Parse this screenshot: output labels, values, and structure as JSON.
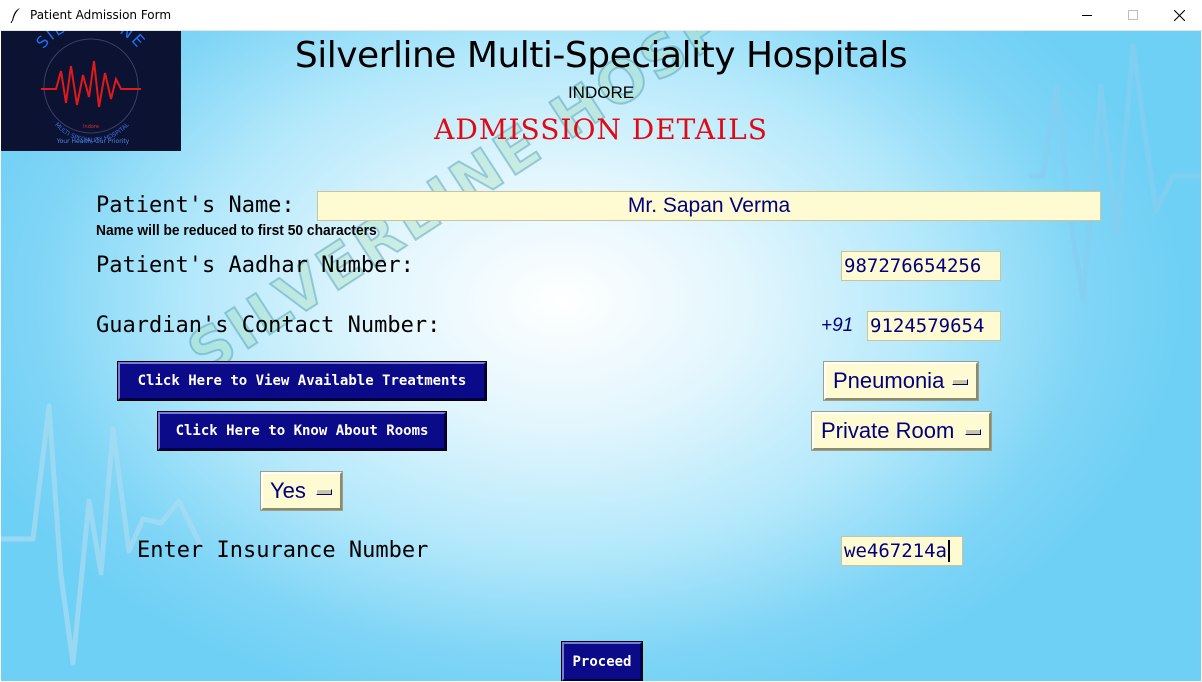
{
  "window": {
    "title": "Patient Admission Form"
  },
  "logo": {
    "brand": "SILVERLINE",
    "subtitle": "MULTI SPECIALITY HOSPITAL",
    "place": "Indore",
    "tagline": "Your Health, Our Priority"
  },
  "header": {
    "hospital_name": "Silverline Multi-Speciality Hospitals",
    "city": "INDORE",
    "heading": "ADMISSION DETAILS"
  },
  "watermark": "SILVERLINE HOSPITALS",
  "form": {
    "name_label": "Patient's Name:",
    "name_value": "Mr. Sapan Verma",
    "name_note": "Name will be reduced to first 50 characters",
    "aadhar_label": "Patient's Aadhar Number:",
    "aadhar_value": "987276654256",
    "contact_label": "Guardian's Contact Number:",
    "contact_prefix": "+91",
    "contact_value": "9124579654",
    "treatments_button": "Click Here to View Available Treatments",
    "treatment_selected": "Pneumonia",
    "rooms_button": "Click Here to Know About Rooms",
    "room_selected": "Private Room",
    "insurance_choice": "Yes",
    "insurance_label": "Enter Insurance Number",
    "insurance_value": "we467214a",
    "proceed_button": "Proceed"
  },
  "colors": {
    "heading_red": "#e00a14",
    "button_navy": "#0b0b8a",
    "field_bg": "#fefad2",
    "field_text": "#00007f",
    "sky_blue": "#6fd0f5"
  },
  "icons": {
    "app": "feather-icon",
    "minimize": "minimize-icon",
    "maximize": "maximize-icon",
    "close": "close-icon",
    "dropdown": "option-menu-indicator-icon"
  }
}
